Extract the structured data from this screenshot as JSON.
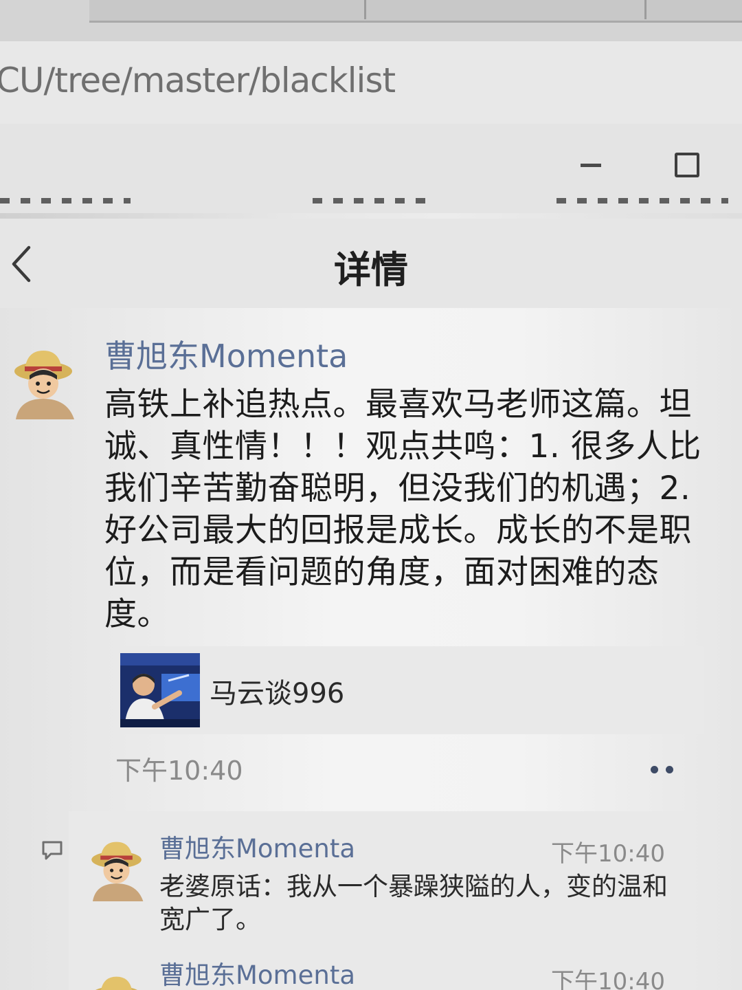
{
  "browser": {
    "url_fragment": "CU/tree/master/blacklist"
  },
  "window": {
    "minimize_icon": "minimize-icon",
    "maximize_icon": "maximize-icon"
  },
  "header": {
    "back_icon": "chevron-left-icon",
    "title": "详情"
  },
  "post": {
    "author": "曹旭东Momenta",
    "text": "高铁上补追热点。最喜欢马老师这篇。坦诚、真性情！！！观点共鸣：1. 很多人比我们辛苦勤奋聪明，但没我们的机遇；2. 好公司最大的回报是成长。成长的不是职位，而是看问题的角度，面对困难的态度。",
    "link": {
      "title": "马云谈996"
    },
    "time": "下午10:40",
    "more_icon": "more-dots-icon"
  },
  "comments": [
    {
      "author": "曹旭东Momenta",
      "time": "下午10:40",
      "text": "老婆原话：我从一个暴躁狭隘的人，变的温和宽广了。"
    },
    {
      "author": "曹旭东Momenta",
      "time": "下午10:40",
      "text": ""
    }
  ],
  "colors": {
    "author_name": "#5a6f96",
    "text": "#1c1c1c",
    "timestamp": "#8a8a8a"
  }
}
